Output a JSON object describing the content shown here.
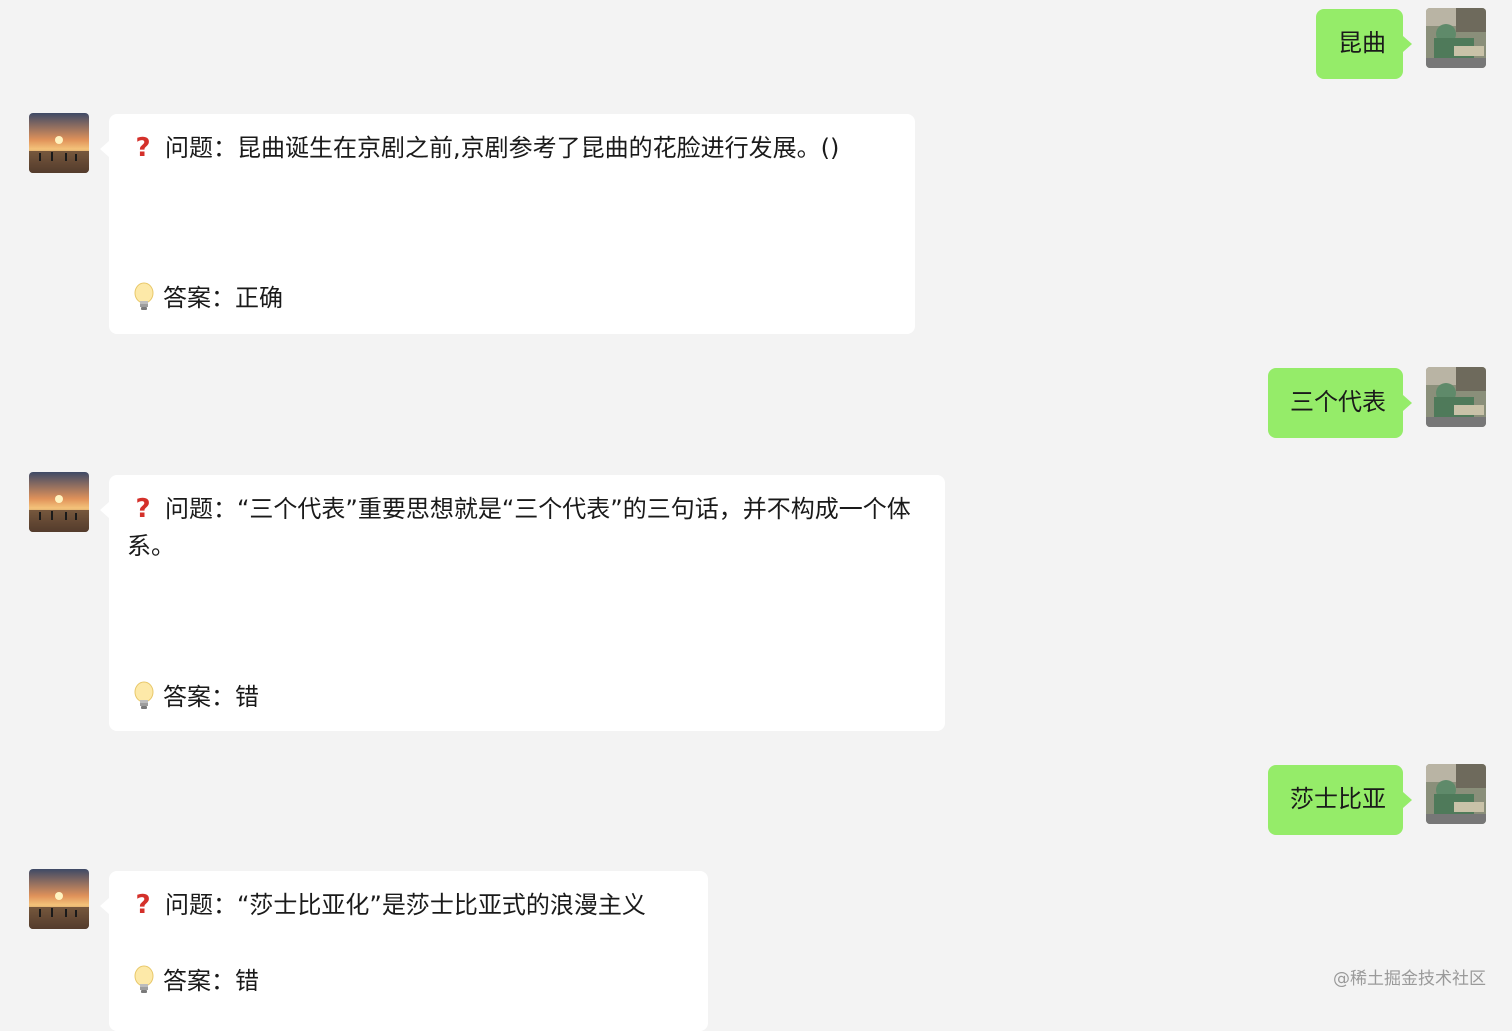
{
  "messages": [
    {
      "sender": "user",
      "text": "昆曲"
    },
    {
      "sender": "bot",
      "question_label": "问题：",
      "question": "昆曲诞生在京剧之前,京剧参考了昆曲的花脸进行发展。()",
      "answer_label": "答案：",
      "answer": "正确"
    },
    {
      "sender": "user",
      "text": "三个代表"
    },
    {
      "sender": "bot",
      "question_label": "问题：",
      "question": "“三个代表”重要思想就是“三个代表”的三句话，并不构成一个体系。",
      "answer_label": "答案：",
      "answer": "错"
    },
    {
      "sender": "user",
      "text": "莎士比亚"
    },
    {
      "sender": "bot",
      "question_label": "问题：",
      "question": "“莎士比亚化”是莎士比亚式的浪漫主义",
      "answer_label": "答案：",
      "answer": "错"
    }
  ],
  "icons": {
    "question": "question-mark-icon",
    "answer": "lightbulb-icon",
    "user_avatar": "user-avatar",
    "bot_avatar": "sunset-avatar"
  },
  "colors": {
    "background": "#f3f3f3",
    "user_bubble": "#95ec69",
    "bot_bubble": "#ffffff",
    "question_mark": "#d4302a"
  },
  "watermark": "@稀土掘金技术社区"
}
